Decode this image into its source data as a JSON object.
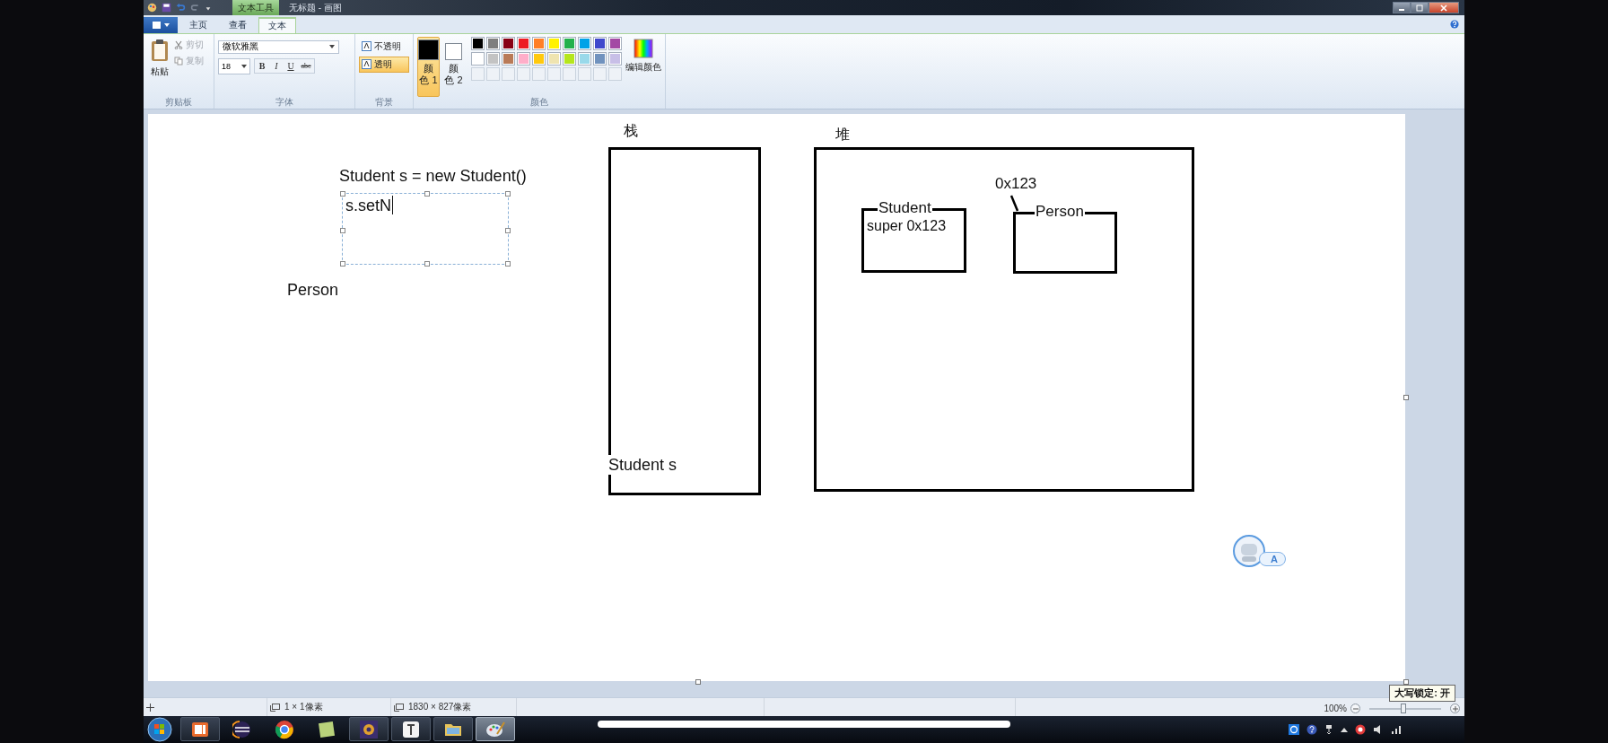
{
  "title_bar": {
    "context_tab": "文本工具",
    "title": "无标题 - 画图"
  },
  "tabs": [
    {
      "label": "主页",
      "selected": false
    },
    {
      "label": "查看",
      "selected": false
    },
    {
      "label": "文本",
      "selected": true
    }
  ],
  "ribbon": {
    "clipboard": {
      "label": "剪贴板",
      "paste": "粘贴",
      "tools": [
        {
          "label": "剪切",
          "kind": "cut",
          "disabled": true
        },
        {
          "label": "复制",
          "kind": "copy",
          "disabled": true
        }
      ]
    },
    "font": {
      "label": "字体",
      "family": "微软雅黑",
      "size": "18",
      "styles": [
        {
          "label": "B",
          "kind": "bold"
        },
        {
          "label": "I",
          "kind": "italic"
        },
        {
          "label": "U",
          "kind": "underline"
        },
        {
          "label": "abc",
          "kind": "strike"
        }
      ]
    },
    "background": {
      "label": "背景",
      "options": [
        {
          "label": "不透明",
          "selected": false
        },
        {
          "label": "透明",
          "selected": true
        }
      ]
    },
    "colors": {
      "label": "颜色",
      "slots": [
        {
          "label": "颜色 1",
          "color": "#000000",
          "selected": true
        },
        {
          "label": "颜色 2",
          "color": "#ffffff",
          "selected": false
        }
      ],
      "palette": [
        {
          "color": "#000000"
        },
        {
          "color": "#7f7f7f"
        },
        {
          "color": "#880015"
        },
        {
          "color": "#ed1c24"
        },
        {
          "color": "#ff7f27"
        },
        {
          "color": "#fff200"
        },
        {
          "color": "#22b14c"
        },
        {
          "color": "#00a2e8"
        },
        {
          "color": "#3f48cc"
        },
        {
          "color": "#a349a4"
        },
        {
          "color": "#ffffff"
        },
        {
          "color": "#c3c3c3"
        },
        {
          "color": "#b97a57"
        },
        {
          "color": "#ffaec9"
        },
        {
          "color": "#ffc90e"
        },
        {
          "color": "#efe4b0"
        },
        {
          "color": "#b5e61d"
        },
        {
          "color": "#99d9ea"
        },
        {
          "color": "#7092be"
        },
        {
          "color": "#c8bfe7"
        }
      ],
      "edit": "编辑颜色"
    }
  },
  "canvas": {
    "statement": "Student s = new Student()",
    "text_box": {
      "value": "s.setN"
    },
    "class_label": "Person",
    "stack": {
      "label": "栈",
      "frame_text": "Student s"
    },
    "heap": {
      "label": "堆",
      "address": "0x123",
      "objects": [
        {
          "title": "Student",
          "body": "super 0x123"
        },
        {
          "title": "Person"
        }
      ]
    },
    "assistant_badge": "A"
  },
  "tooltip": "大写锁定: 开",
  "status_bar": {
    "selection_size": "1 × 1像素",
    "canvas_size": "1830 × 827像素",
    "zoom": "100%",
    "zoom_slider": {
      "level": 0.47
    }
  },
  "taskbar": {
    "apps": [
      {
        "kind": "slides",
        "running": true,
        "selected": false
      },
      {
        "kind": "ide",
        "running": false,
        "selected": false
      },
      {
        "kind": "browser",
        "running": false,
        "selected": false
      },
      {
        "kind": "notes",
        "running": false,
        "selected": false
      },
      {
        "kind": "game",
        "running": true,
        "selected": false
      },
      {
        "kind": "text",
        "running": true,
        "selected": false
      },
      {
        "kind": "folder",
        "running": true,
        "selected": false
      },
      {
        "kind": "paint",
        "running": true,
        "selected": true
      }
    ]
  }
}
